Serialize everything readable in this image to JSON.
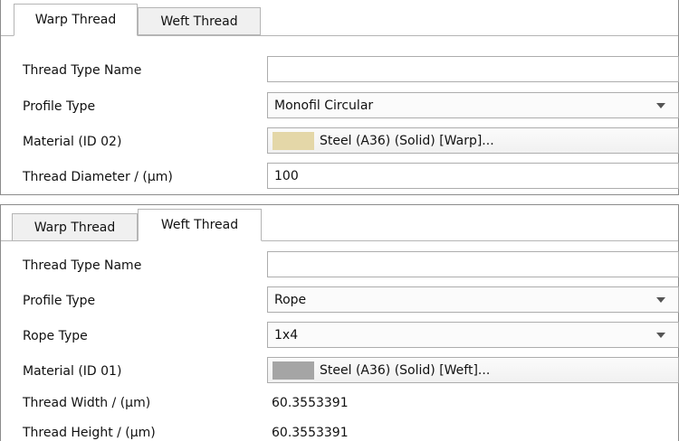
{
  "top_panel": {
    "tabs": [
      {
        "label": "Warp Thread",
        "active": true
      },
      {
        "label": "Weft Thread",
        "active": false
      }
    ],
    "rows": {
      "thread_type_name": {
        "label": "Thread Type Name",
        "value": "",
        "placeholder": ""
      },
      "profile_type": {
        "label": "Profile Type",
        "value": "Monofil Circular"
      },
      "material": {
        "label": "Material (ID 02)",
        "value": "Steel (A36) (Solid) [Warp]...",
        "swatch_color": "#e4d7a8"
      },
      "thread_diameter": {
        "label": "Thread Diameter / (μm)",
        "value": "100"
      }
    }
  },
  "bottom_panel": {
    "tabs": [
      {
        "label": "Warp Thread",
        "active": false
      },
      {
        "label": "Weft Thread",
        "active": true
      }
    ],
    "rows": {
      "thread_type_name": {
        "label": "Thread Type Name",
        "value": "",
        "placeholder": ""
      },
      "profile_type": {
        "label": "Profile Type",
        "value": "Rope"
      },
      "rope_type": {
        "label": "Rope Type",
        "value": "1x4"
      },
      "material": {
        "label": "Material (ID 01)",
        "value": "Steel (A36) (Solid) [Weft]...",
        "swatch_color": "#a5a5a5"
      },
      "thread_width": {
        "label": "Thread Width / (μm)",
        "value": "60.3553391"
      },
      "thread_height": {
        "label": "Thread Height / (μm)",
        "value": "60.3553391"
      }
    }
  },
  "colors": {
    "border": "#adadad",
    "tab_inactive_bg": "#f0f0f0",
    "dropdown_arrow": "#555555"
  }
}
